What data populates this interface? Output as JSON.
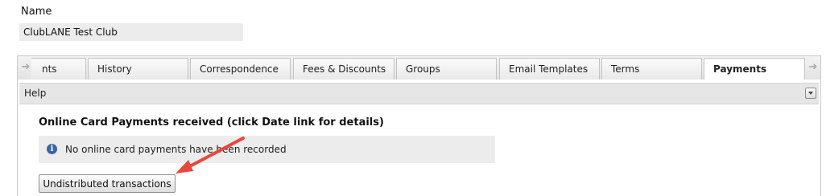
{
  "header": {
    "name_label": "Name",
    "name_value": "ClubLANE Test Club"
  },
  "tabs": {
    "scroll_left_icon": "arrow-left-icon",
    "scroll_right_icon": "arrow-right-icon",
    "items": [
      {
        "label": "nts"
      },
      {
        "label": "History"
      },
      {
        "label": "Correspondence"
      },
      {
        "label": "Fees & Discounts"
      },
      {
        "label": "Groups"
      },
      {
        "label": "Email Templates"
      },
      {
        "label": "Terms"
      },
      {
        "label": "Payments",
        "active": true
      }
    ]
  },
  "help": {
    "label": "Help",
    "toggle_icon": "chevron-down-icon"
  },
  "payments": {
    "title": "Online Card Payments received (click Date link for details)",
    "info_icon": "info-icon",
    "empty_message": "No online card payments have been recorded",
    "undistributed_button": "Undistributed transactions"
  },
  "annotation": {
    "arrow_color": "#e8473f"
  }
}
